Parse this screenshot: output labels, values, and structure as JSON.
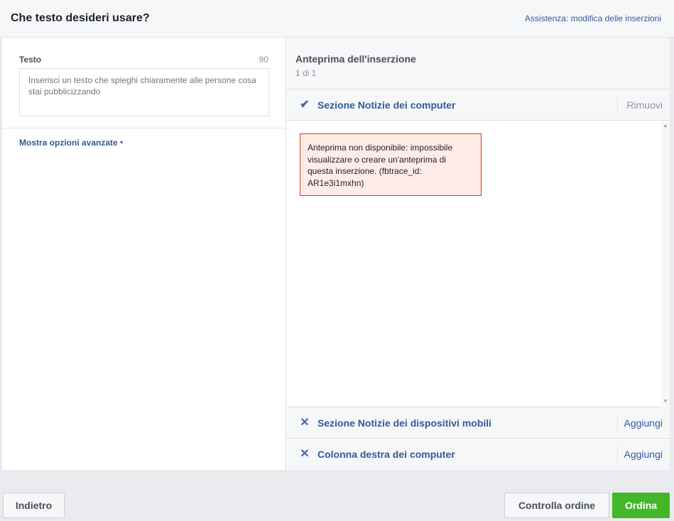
{
  "header": {
    "title": "Che testo desideri usare?",
    "help_link": "Assistenza: modifica delle inserzioni"
  },
  "left": {
    "text_label": "Testo",
    "char_count": "90",
    "textarea_placeholder": "Inserisci un testo che spieghi chiaramente alle persone cosa stai pubblicizzando",
    "advanced_link": "Mostra opzioni avanzate"
  },
  "preview": {
    "title": "Anteprima dell'inserzione",
    "pager": "1 di 1",
    "error_message": "Anteprima non disponibile: impossibile visualizzare o creare un'anteprima di questa inserzione. (fbtrace_id: AR1e3i1mxhn)",
    "placements": [
      {
        "label": "Sezione Notizie dei computer",
        "action": "Rimuovi",
        "icon": "check-icon"
      },
      {
        "label": "Sezione Notizie dei dispositivi mobili",
        "action": "Aggiungi",
        "icon": "x-icon"
      },
      {
        "label": "Colonna destra dei computer",
        "action": "Aggiungi",
        "icon": "x-icon"
      }
    ]
  },
  "footer": {
    "back_label": "Indietro",
    "review_label": "Controlla ordine",
    "order_label": "Ordina"
  },
  "colors": {
    "accent": "#365899",
    "primary_button": "#42b72a",
    "error_bg": "#ffebe8",
    "error_border": "#dd3c10"
  }
}
